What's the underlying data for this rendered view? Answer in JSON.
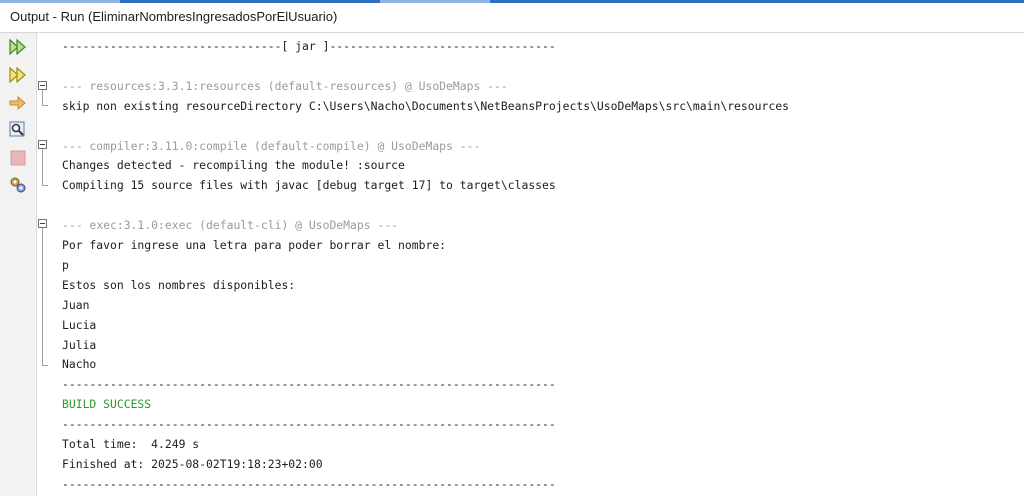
{
  "window": {
    "title": "Output - Run (EliminarNombresIngresadosPorElUsuario)"
  },
  "toolbar": {
    "buttons": [
      {
        "name": "rerun",
        "icon": "double-play-icon"
      },
      {
        "name": "rerun-with-arguments",
        "icon": "double-play-icon"
      },
      {
        "name": "stop",
        "icon": "arrow-right-icon"
      },
      {
        "name": "find",
        "icon": "magnifier-icon"
      },
      {
        "name": "stop-build",
        "icon": "stop-square-icon"
      },
      {
        "name": "settings",
        "icon": "gears-icon"
      }
    ]
  },
  "colors": {
    "success": "#2b9a2b",
    "dim": "#9a9a9a",
    "text": "#202020"
  },
  "console": {
    "lines": [
      {
        "text": "--------------------------------[ jar ]---------------------------------",
        "style": "normal"
      },
      {
        "text": "",
        "style": "normal"
      },
      {
        "text": "--- resources:3.3.1:resources (default-resources) @ UsoDeMaps ---",
        "style": "grey"
      },
      {
        "text": "skip non existing resourceDirectory C:\\Users\\Nacho\\Documents\\NetBeansProjects\\UsoDeMaps\\src\\main\\resources",
        "style": "normal"
      },
      {
        "text": "",
        "style": "normal"
      },
      {
        "text": "--- compiler:3.11.0:compile (default-compile) @ UsoDeMaps ---",
        "style": "grey"
      },
      {
        "text": "Changes detected - recompiling the module! :source",
        "style": "normal"
      },
      {
        "text": "Compiling 15 source files with javac [debug target 17] to target\\classes",
        "style": "normal"
      },
      {
        "text": "",
        "style": "normal"
      },
      {
        "text": "--- exec:3.1.0:exec (default-cli) @ UsoDeMaps ---",
        "style": "grey"
      },
      {
        "text": "Por favor ingrese una letra para poder borrar el nombre:",
        "style": "normal"
      },
      {
        "text": "p",
        "style": "normal"
      },
      {
        "text": "Estos son los nombres disponibles:",
        "style": "normal"
      },
      {
        "text": "Juan",
        "style": "normal"
      },
      {
        "text": "Lucia",
        "style": "normal"
      },
      {
        "text": "Julia",
        "style": "normal"
      },
      {
        "text": "Nacho",
        "style": "normal"
      },
      {
        "text": "------------------------------------------------------------------------",
        "style": "normal"
      },
      {
        "text": "BUILD SUCCESS",
        "style": "green"
      },
      {
        "text": "------------------------------------------------------------------------",
        "style": "normal"
      },
      {
        "text": "Total time:  4.249 s",
        "style": "normal"
      },
      {
        "text": "Finished at: 2025-08-02T19:18:23+02:00",
        "style": "normal"
      },
      {
        "text": "------------------------------------------------------------------------",
        "style": "normal"
      }
    ]
  }
}
